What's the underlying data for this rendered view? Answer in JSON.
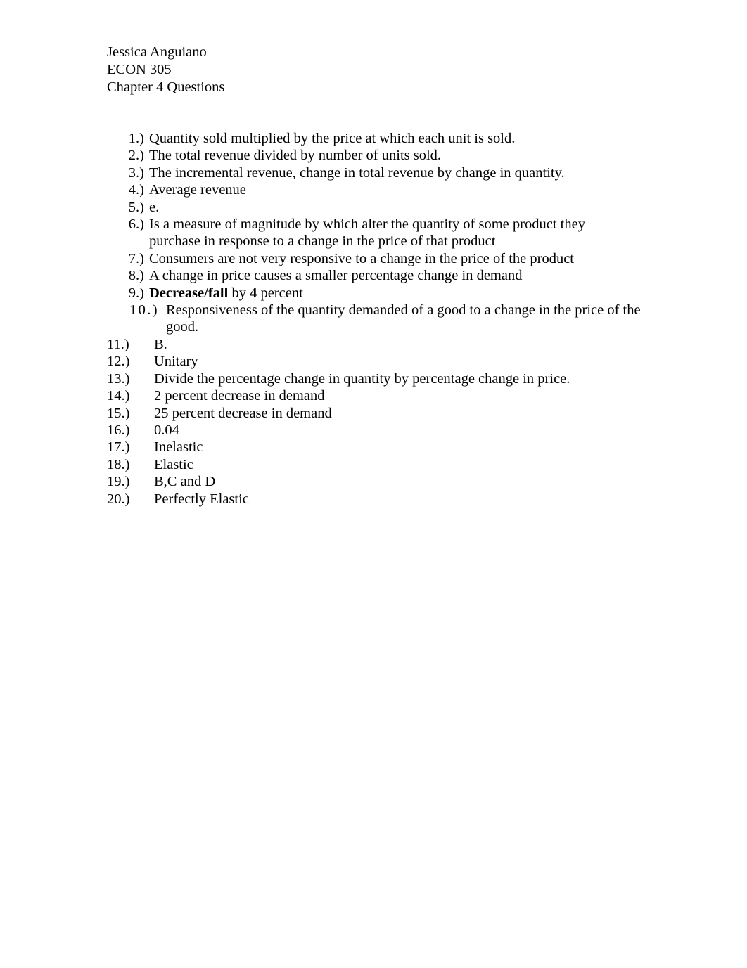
{
  "document": {
    "header": {
      "author": "Jessica Anguiano",
      "course": "ECON 305",
      "title": "Chapter 4 Questions"
    },
    "answers": [
      {
        "number": "1.)",
        "group": "a",
        "text": "Quantity sold multiplied by the price at which each unit is sold."
      },
      {
        "number": "2.)",
        "group": "a",
        "text": "The total revenue divided by number of units sold."
      },
      {
        "number": "3.)",
        "group": "a",
        "text": "The incremental revenue, change in total revenue by change in quantity."
      },
      {
        "number": "4.)",
        "group": "a",
        "text": "Average revenue"
      },
      {
        "number": "5.)",
        "group": "a",
        "text": "e."
      },
      {
        "number": "6.)",
        "group": "a",
        "text": "Is a measure of magnitude by which alter the quantity of some product they purchase in response to a change in the price of that product"
      },
      {
        "number": "7.)",
        "group": "a",
        "text": "Consumers are not very responsive to a change in the price of the product"
      },
      {
        "number": "8.)",
        "group": "a",
        "text": "A change in price causes a smaller percentage change in demand"
      },
      {
        "number": "9.)",
        "group": "a",
        "rich": true,
        "parts": [
          {
            "text": "Decrease/fall",
            "bold": true
          },
          {
            "text": " by ",
            "bold": false
          },
          {
            "text": "4",
            "bold": true
          },
          {
            "text": " percent",
            "bold": false
          }
        ],
        "text": "Decrease/fall by 4 percent"
      },
      {
        "number": "10.)",
        "group": "b",
        "text": "Responsiveness of the quantity demanded of a good to a change in the price of the good."
      },
      {
        "number": "11.)",
        "group": "c",
        "text": "B."
      },
      {
        "number": "12.)",
        "group": "c",
        "text": "Unitary"
      },
      {
        "number": "13.)",
        "group": "c",
        "text": "Divide the percentage change in quantity by percentage change in price."
      },
      {
        "number": "14.)",
        "group": "c",
        "text": "2 percent decrease in demand"
      },
      {
        "number": "15.)",
        "group": "c",
        "text": "25 percent decrease in demand"
      },
      {
        "number": "16.)",
        "group": "c",
        "text": "0.04"
      },
      {
        "number": "17.)",
        "group": "c",
        "text": "Inelastic"
      },
      {
        "number": "18.)",
        "group": "c",
        "text": "Elastic"
      },
      {
        "number": "19.)",
        "group": "c",
        "text": "B,C and D"
      },
      {
        "number": "20.)",
        "group": "c",
        "text": "Perfectly Elastic"
      }
    ]
  },
  "colors": {
    "page_background": "#ffffff",
    "text": "#000000"
  }
}
